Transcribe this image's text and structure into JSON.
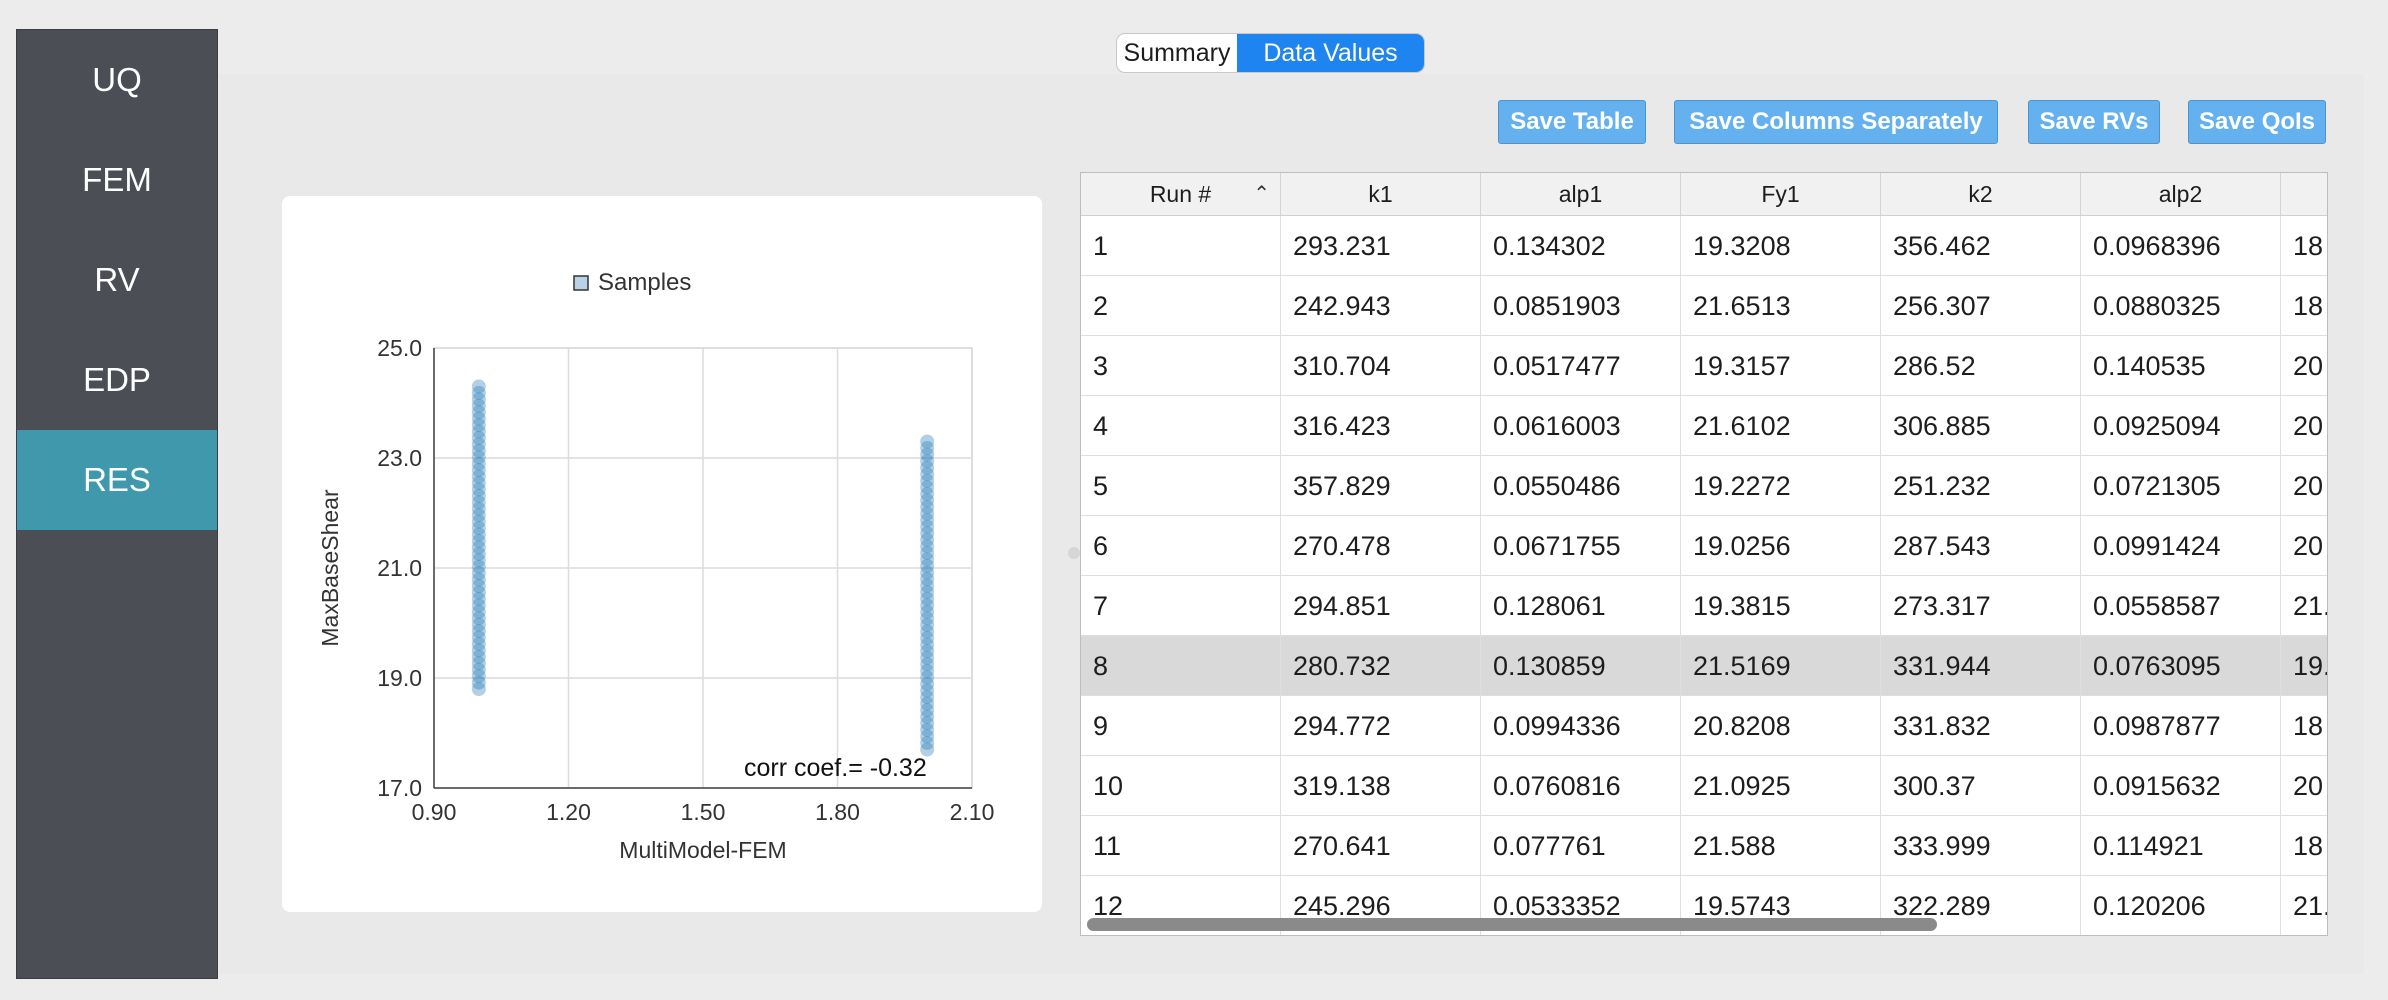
{
  "sidebar": {
    "items": [
      {
        "label": "UQ"
      },
      {
        "label": "FEM"
      },
      {
        "label": "RV"
      },
      {
        "label": "EDP"
      },
      {
        "label": "RES"
      }
    ],
    "active_index": 4
  },
  "tabs": {
    "summary": "Summary",
    "data_values": "Data Values",
    "active": "Data Values"
  },
  "buttons": {
    "save_table": "Save Table",
    "save_columns": "Save Columns Separately",
    "save_rvs": "Save RVs",
    "save_qois": "Save QoIs"
  },
  "chart_data": {
    "type": "scatter",
    "legend": "Samples",
    "xlabel": "MultiModel-FEM",
    "ylabel": "MaxBaseShear",
    "xlim": [
      0.9,
      2.1
    ],
    "ylim": [
      17.0,
      25.0
    ],
    "xticks": [
      "0.90",
      "1.20",
      "1.50",
      "1.80",
      "2.10"
    ],
    "yticks": [
      "17.0",
      "19.0",
      "21.0",
      "23.0",
      "25.0"
    ],
    "annotation": "corr coef.= -0.32",
    "grid": true,
    "series": [
      {
        "x": 1.0,
        "y_range": [
          18.8,
          24.3
        ]
      },
      {
        "x": 2.0,
        "y_range": [
          17.7,
          23.3
        ]
      }
    ],
    "color": "#1f78b4"
  },
  "table": {
    "columns": [
      "Run #",
      "k1",
      "alp1",
      "Fy1",
      "k2",
      "alp2",
      ""
    ],
    "rows": [
      [
        "1",
        "293.231",
        "0.134302",
        "19.3208",
        "356.462",
        "0.0968396",
        "18"
      ],
      [
        "2",
        "242.943",
        "0.0851903",
        "21.6513",
        "256.307",
        "0.0880325",
        "18"
      ],
      [
        "3",
        "310.704",
        "0.0517477",
        "19.3157",
        "286.52",
        "0.140535",
        "20"
      ],
      [
        "4",
        "316.423",
        "0.0616003",
        "21.6102",
        "306.885",
        "0.0925094",
        "20"
      ],
      [
        "5",
        "357.829",
        "0.0550486",
        "19.2272",
        "251.232",
        "0.0721305",
        "20"
      ],
      [
        "6",
        "270.478",
        "0.0671755",
        "19.0256",
        "287.543",
        "0.0991424",
        "20"
      ],
      [
        "7",
        "294.851",
        "0.128061",
        "19.3815",
        "273.317",
        "0.0558587",
        "21."
      ],
      [
        "8",
        "280.732",
        "0.130859",
        "21.5169",
        "331.944",
        "0.0763095",
        "19."
      ],
      [
        "9",
        "294.772",
        "0.0994336",
        "20.8208",
        "331.832",
        "0.0987877",
        "18"
      ],
      [
        "10",
        "319.138",
        "0.0760816",
        "21.0925",
        "300.37",
        "0.0915632",
        "20"
      ],
      [
        "11",
        "270.641",
        "0.077761",
        "21.588",
        "333.999",
        "0.114921",
        "18"
      ],
      [
        "12",
        "245.296",
        "0.0533352",
        "19.5743",
        "322.289",
        "0.120206",
        "21."
      ]
    ],
    "selected_row": 8
  }
}
